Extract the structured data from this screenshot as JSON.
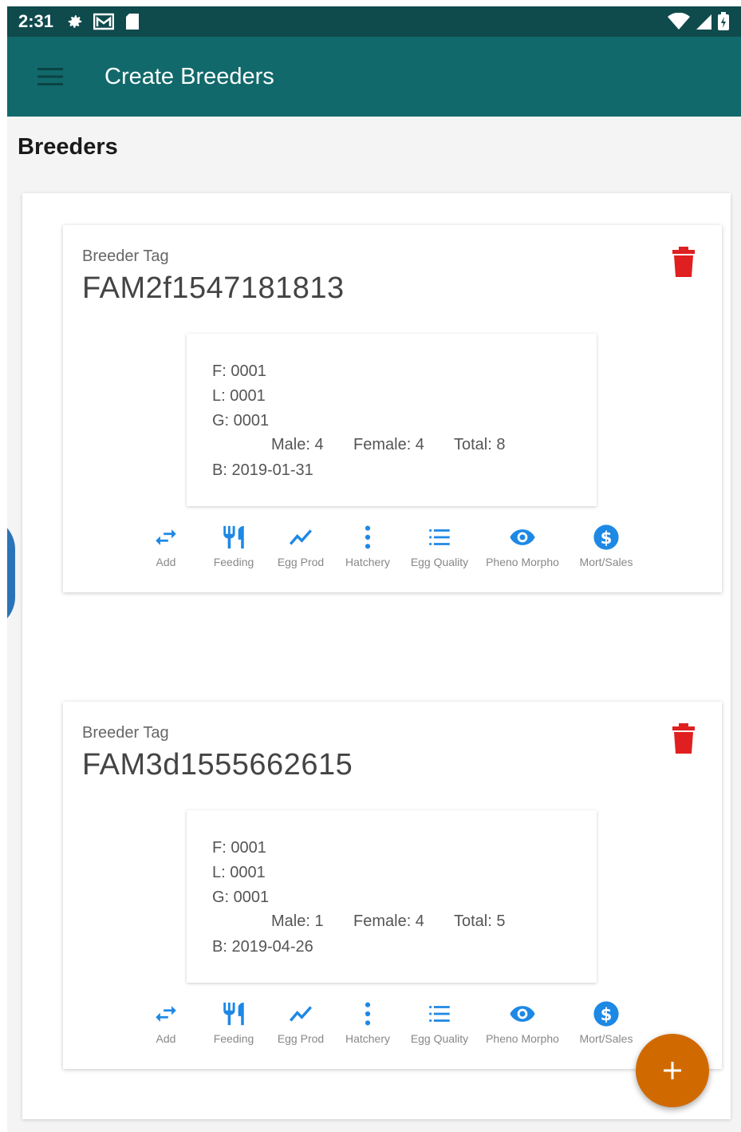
{
  "status_bar": {
    "time": "2:31"
  },
  "app_bar": {
    "title": "Create Breeders"
  },
  "section": {
    "title": "Breeders"
  },
  "colors": {
    "appbar": "#11696b",
    "statusbar": "#0f4a4c",
    "accent_blue": "#1e88e5",
    "delete_red": "#e02020",
    "fab": "#d06a00"
  },
  "actions": [
    {
      "label": "Add",
      "icon": "swap-arrows-icon"
    },
    {
      "label": "Feeding",
      "icon": "restaurant-icon"
    },
    {
      "label": "Egg Prod",
      "icon": "trend-line-icon"
    },
    {
      "label": "Hatchery",
      "icon": "more-vert-icon"
    },
    {
      "label": "Egg Quality",
      "icon": "list-icon"
    },
    {
      "label": "Pheno Morpho",
      "icon": "eye-icon"
    },
    {
      "label": "Mort/Sales",
      "icon": "dollar-icon"
    }
  ],
  "breeders": [
    {
      "label": "Breeder Tag",
      "tag": "FAM2f1547181813",
      "f": "F: 0001",
      "l": "L: 0001",
      "g": "G: 0001",
      "male": "Male: 4",
      "female": "Female: 4",
      "total": "Total: 8",
      "b": "B: 2019-01-31"
    },
    {
      "label": "Breeder Tag",
      "tag": "FAM3d1555662615",
      "f": "F: 0001",
      "l": "L: 0001",
      "g": "G: 0001",
      "male": "Male: 1",
      "female": "Female: 4",
      "total": "Total: 5",
      "b": "B: 2019-04-26"
    }
  ],
  "fab": {
    "icon": "plus-icon"
  }
}
